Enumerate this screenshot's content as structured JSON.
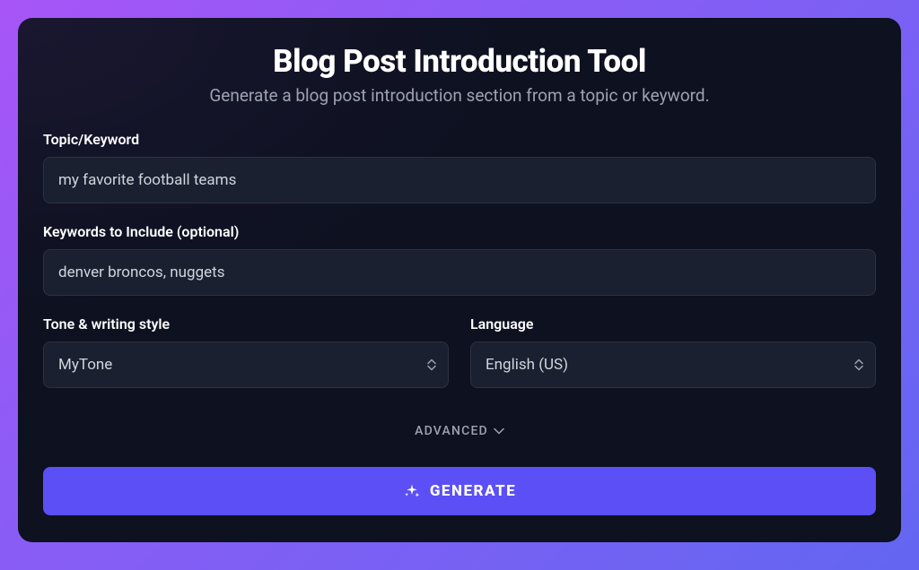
{
  "header": {
    "title": "Blog Post Introduction Tool",
    "subtitle": "Generate a blog post introduction section from a topic or keyword."
  },
  "fields": {
    "topic": {
      "label": "Topic/Keyword",
      "value": "my favorite football teams"
    },
    "keywords": {
      "label": "Keywords to Include (optional)",
      "value": "denver broncos, nuggets"
    },
    "tone": {
      "label": "Tone & writing style",
      "selected": "MyTone"
    },
    "language": {
      "label": "Language",
      "selected": "English (US)"
    }
  },
  "advanced": {
    "label": "ADVANCED"
  },
  "actions": {
    "generate": "GENERATE"
  }
}
